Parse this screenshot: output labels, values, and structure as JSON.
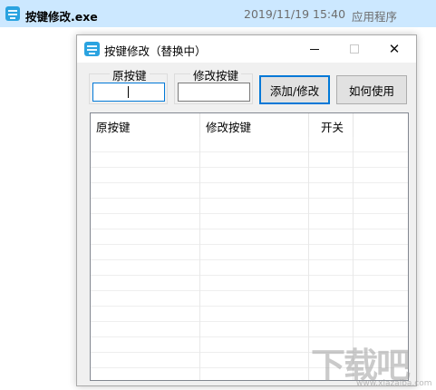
{
  "explorer_row": {
    "file_name": "按键修改.exe",
    "date_modified": "2019/11/19 15:40",
    "file_type": "应用程序",
    "icon": "keyboard-icon"
  },
  "window": {
    "title": "按键修改（替换中）",
    "icon": "keyboard-icon",
    "minimize_symbol": "",
    "maximize_symbol": "",
    "close_symbol": "✕"
  },
  "form": {
    "original_key_label": "原按键",
    "original_key_value": "",
    "modified_key_label": "修改按键",
    "modified_key_value": "",
    "add_modify_button": "添加/修改",
    "how_to_use_button": "如何使用"
  },
  "list": {
    "columns": [
      "原按键",
      "修改按键",
      "开关"
    ],
    "rows": []
  },
  "watermark": {
    "text": "下载吧",
    "url": "www.xiazaiba.com"
  },
  "colors": {
    "selection_highlight": "#cce8ff",
    "focus_accent": "#0078d7",
    "client_background": "#f0f0f0"
  }
}
